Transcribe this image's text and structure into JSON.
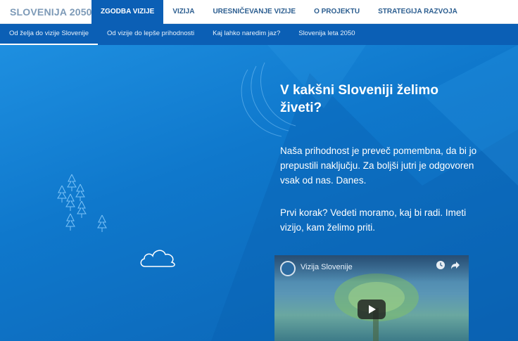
{
  "brand": "SLOVENIJA 2050",
  "topnav": [
    {
      "label": "ZGODBA VIZIJE",
      "active": true
    },
    {
      "label": "VIZIJA",
      "active": false
    },
    {
      "label": "URESNIČEVANJE VIZIJE",
      "active": false
    },
    {
      "label": "O PROJEKTU",
      "active": false
    },
    {
      "label": "STRATEGIJA RAZVOJA",
      "active": false
    }
  ],
  "subnav": [
    {
      "label": "Od želja do vizije Slovenije",
      "active": true
    },
    {
      "label": "Od vizije do lepše prihodnosti",
      "active": false
    },
    {
      "label": "Kaj lahko naredim jaz?",
      "active": false
    },
    {
      "label": "Slovenija leta 2050",
      "active": false
    }
  ],
  "hero": {
    "title": "V kakšni Sloveniji želimo živeti?",
    "paragraph1": "Naša prihodnost je preveč pomembna, da bi jo prepustili naključju. Za boljši jutri je odgovoren vsak od nas. Danes.",
    "paragraph2": "Prvi korak? Vedeti moramo, kaj bi radi. Imeti vizijo, kam želimo priti."
  },
  "video": {
    "title": "Vizija Slovenije",
    "icons": [
      "channel-logo-icon",
      "watch-later-icon",
      "share-icon",
      "play-icon"
    ]
  },
  "colors": {
    "nav_active": "#0b5fb5",
    "hero_light": "#1e8fe0",
    "hero_dark": "#0b63b3",
    "brand_text": "#7d9ab7"
  }
}
